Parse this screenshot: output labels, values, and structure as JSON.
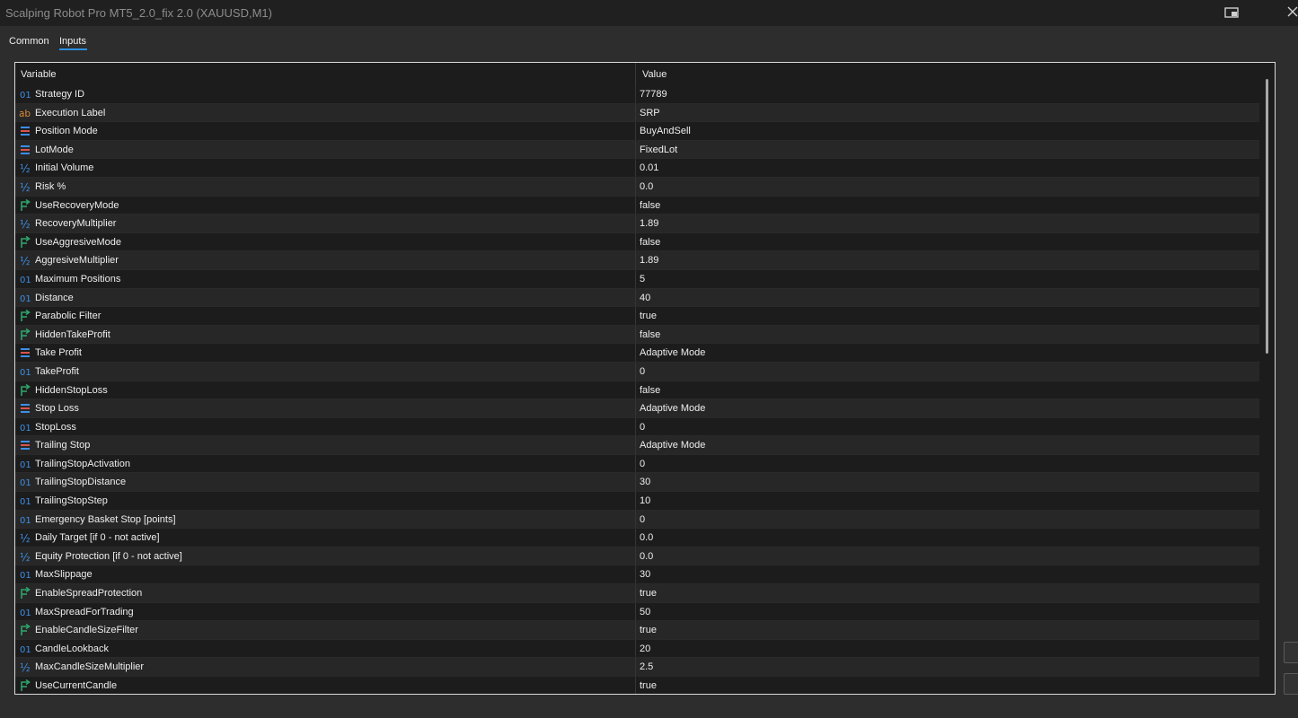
{
  "window": {
    "title": "Scalping Robot Pro MT5_2.0_fix 2.0 (XAUUSD,M1)"
  },
  "tabs": [
    {
      "label": "Common",
      "active": false
    },
    {
      "label": "Inputs",
      "active": true
    }
  ],
  "grid": {
    "headers": {
      "variable": "Variable",
      "value": "Value"
    },
    "rows": [
      {
        "type": "int",
        "variable": "Strategy ID",
        "value": "77789"
      },
      {
        "type": "string",
        "variable": "Execution Label",
        "value": "SRP"
      },
      {
        "type": "enum",
        "variable": "Position Mode",
        "value": "BuyAndSell"
      },
      {
        "type": "enum",
        "variable": "LotMode",
        "value": "FixedLot"
      },
      {
        "type": "double",
        "variable": "Initial Volume",
        "value": "0.01"
      },
      {
        "type": "double",
        "variable": "Risk %",
        "value": "0.0"
      },
      {
        "type": "bool",
        "variable": "UseRecoveryMode",
        "value": "false"
      },
      {
        "type": "double",
        "variable": "RecoveryMultiplier",
        "value": "1.89"
      },
      {
        "type": "bool",
        "variable": "UseAggresiveMode",
        "value": "false"
      },
      {
        "type": "double",
        "variable": "AggresiveMultiplier",
        "value": "1.89"
      },
      {
        "type": "int",
        "variable": "Maximum Positions",
        "value": "5"
      },
      {
        "type": "int",
        "variable": "Distance",
        "value": "40"
      },
      {
        "type": "bool",
        "variable": "Parabolic Filter",
        "value": "true"
      },
      {
        "type": "bool",
        "variable": "HiddenTakeProfit",
        "value": "false"
      },
      {
        "type": "enum",
        "variable": "Take Profit",
        "value": "Adaptive Mode"
      },
      {
        "type": "int",
        "variable": "TakeProfit",
        "value": "0"
      },
      {
        "type": "bool",
        "variable": "HiddenStopLoss",
        "value": "false"
      },
      {
        "type": "enum",
        "variable": "Stop Loss",
        "value": "Adaptive Mode"
      },
      {
        "type": "int",
        "variable": "StopLoss",
        "value": "0"
      },
      {
        "type": "enum",
        "variable": "Trailing Stop",
        "value": "Adaptive Mode"
      },
      {
        "type": "int",
        "variable": "TrailingStopActivation",
        "value": "0"
      },
      {
        "type": "int",
        "variable": "TrailingStopDistance",
        "value": "30"
      },
      {
        "type": "int",
        "variable": "TrailingStopStep",
        "value": "10"
      },
      {
        "type": "int",
        "variable": "Emergency Basket Stop [points]",
        "value": "0"
      },
      {
        "type": "double",
        "variable": "Daily Target [if 0 - not active]",
        "value": "0.0"
      },
      {
        "type": "double",
        "variable": "Equity Protection [if 0 - not active]",
        "value": "0.0"
      },
      {
        "type": "int",
        "variable": "MaxSlippage",
        "value": "30"
      },
      {
        "type": "bool",
        "variable": "EnableSpreadProtection",
        "value": "true"
      },
      {
        "type": "int",
        "variable": "MaxSpreadForTrading",
        "value": "50"
      },
      {
        "type": "bool",
        "variable": "EnableCandleSizeFilter",
        "value": "true"
      },
      {
        "type": "int",
        "variable": "CandleLookback",
        "value": "20"
      },
      {
        "type": "double",
        "variable": "MaxCandleSizeMultiplier",
        "value": "2.5"
      },
      {
        "type": "bool",
        "variable": "UseCurrentCandle",
        "value": "true"
      }
    ]
  },
  "icons": {
    "int": "int-type-icon",
    "string": "string-type-icon",
    "enum": "enum-type-icon",
    "double": "double-type-icon",
    "bool": "bool-type-icon"
  },
  "icon_glyphs": {
    "int": "01",
    "string": "ab",
    "double": "½"
  },
  "colors": {
    "icon_blue": "#3d8ee6",
    "icon_orange": "#d98a3a",
    "icon_green": "#2ea36b",
    "icon_red": "#d9534f",
    "tab_underline": "#2d8fe0"
  }
}
